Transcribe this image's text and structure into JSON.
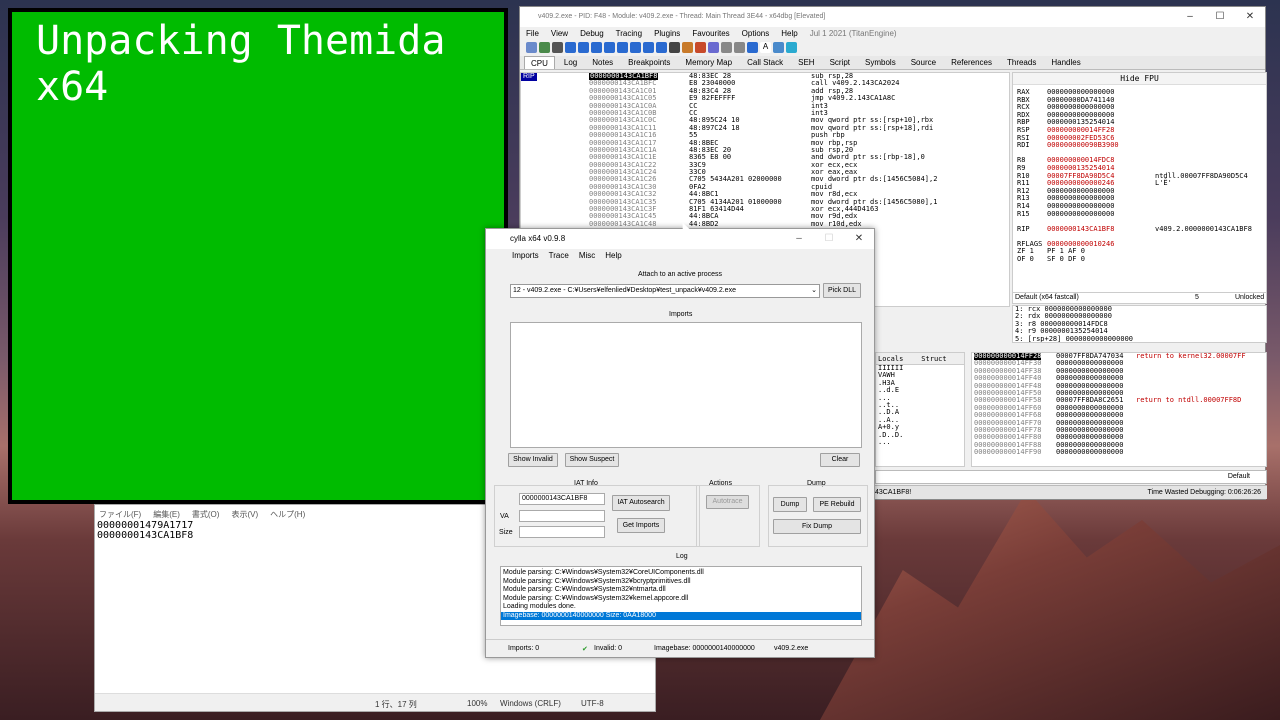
{
  "overlay": {
    "title": "Unpacking Themida x64"
  },
  "notepad": {
    "menu": [
      "ファイル(F)",
      "編集(E)",
      "書式(O)",
      "表示(V)",
      "ヘルプ(H)"
    ],
    "lines": [
      "00000001479A1717",
      "0000000143CA1BF8"
    ],
    "status": {
      "position": "1 行、17 列",
      "zoom": "100%",
      "eol": "Windows (CRLF)",
      "encoding": "UTF-8"
    }
  },
  "dbg": {
    "title": "v409.2.exe - PID: F48 - Module: v409.2.exe - Thread: Main Thread 3E44 - x64dbg [Elevated]",
    "menu": [
      "File",
      "View",
      "Debug",
      "Tracing",
      "Plugins",
      "Favourites",
      "Options",
      "Help",
      "Jul 1 2021 (TitanEngine)"
    ],
    "tabs": [
      "CPU",
      "Log",
      "Notes",
      "Breakpoints",
      "Memory Map",
      "Call Stack",
      "SEH",
      "Script",
      "Symbols",
      "Source",
      "References",
      "Threads",
      "Handles"
    ],
    "rip_tag": "RIP",
    "disasm": [
      {
        "addr": "0000000143CA1BF8",
        "bytes": "48:83EC 28",
        "instr": "sub rsp,28",
        "sel": true
      },
      {
        "addr": "0000000143CA1BFC",
        "bytes": "E8 23040000",
        "instr": "call v409.2.143CA2024"
      },
      {
        "addr": "0000000143CA1C01",
        "bytes": "48:83C4 28",
        "instr": "add rsp,28"
      },
      {
        "addr": "0000000143CA1C05",
        "bytes": "E9 82FEFFFF",
        "instr": "jmp v409.2.143CA1A8C"
      },
      {
        "addr": "0000000143CA1C0A",
        "bytes": "CC",
        "instr": "int3"
      },
      {
        "addr": "0000000143CA1C0B",
        "bytes": "CC",
        "instr": "int3"
      },
      {
        "addr": "0000000143CA1C0C",
        "bytes": "48:895C24 10",
        "instr": "mov qword ptr ss:[rsp+10],rbx"
      },
      {
        "addr": "0000000143CA1C11",
        "bytes": "48:897C24 18",
        "instr": "mov qword ptr ss:[rsp+18],rdi"
      },
      {
        "addr": "0000000143CA1C16",
        "bytes": "55",
        "instr": "push rbp"
      },
      {
        "addr": "0000000143CA1C17",
        "bytes": "48:8BEC",
        "instr": "mov rbp,rsp"
      },
      {
        "addr": "0000000143CA1C1A",
        "bytes": "48:83EC 20",
        "instr": "sub rsp,20"
      },
      {
        "addr": "0000000143CA1C1E",
        "bytes": "8365 E8 00",
        "instr": "and dword ptr ss:[rbp-18],0"
      },
      {
        "addr": "0000000143CA1C22",
        "bytes": "33C9",
        "instr": "xor ecx,ecx"
      },
      {
        "addr": "0000000143CA1C24",
        "bytes": "33C0",
        "instr": "xor eax,eax"
      },
      {
        "addr": "0000000143CA1C26",
        "bytes": "C705 5434A201 02000000",
        "instr": "mov dword ptr ds:[1456C5084],2"
      },
      {
        "addr": "0000000143CA1C30",
        "bytes": "0FA2",
        "instr": "cpuid"
      },
      {
        "addr": "0000000143CA1C32",
        "bytes": "44:8BC1",
        "instr": "mov r8d,ecx"
      },
      {
        "addr": "0000000143CA1C35",
        "bytes": "C705 4134A201 01000000",
        "instr": "mov dword ptr ds:[1456C5080],1"
      },
      {
        "addr": "0000000143CA1C3F",
        "bytes": "81F1 63414D44",
        "instr": "xor ecx,444D4163"
      },
      {
        "addr": "0000000143CA1C45",
        "bytes": "44:8BCA",
        "instr": "mov r9d,edx"
      },
      {
        "addr": "0000000143CA1C48",
        "bytes": "44:8BD2",
        "instr": "mov r10d,edx"
      }
    ],
    "regs_header": "Hide FPU",
    "regs": [
      {
        "n": "RAX",
        "v": "0000000000000000"
      },
      {
        "n": "RBX",
        "v": "00000000DA741140"
      },
      {
        "n": "RCX",
        "v": "0000000000000000"
      },
      {
        "n": "RDX",
        "v": "0000000000000000"
      },
      {
        "n": "RBP",
        "v": "0000000135254014"
      },
      {
        "n": "RSP",
        "v": "000000000014FF28",
        "red": true
      },
      {
        "n": "RSI",
        "v": "000000002FED53C6",
        "red": true
      },
      {
        "n": "RDI",
        "v": "000000000090B3900",
        "red": true
      },
      {
        "n": "",
        "v": ""
      },
      {
        "n": "R8",
        "v": "000000000014FDC8",
        "red": true
      },
      {
        "n": "R9",
        "v": "0000000135254014",
        "red": true
      },
      {
        "n": "R10",
        "v": "00007FF8DA90D5C4",
        "red": true,
        "c": "ntdll.00007FF8DA90D5C4"
      },
      {
        "n": "R11",
        "v": "0000000000000246",
        "red": true,
        "c": "L'Ȇ'"
      },
      {
        "n": "R12",
        "v": "0000000000000000"
      },
      {
        "n": "R13",
        "v": "0000000000000000"
      },
      {
        "n": "R14",
        "v": "0000000000000000"
      },
      {
        "n": "R15",
        "v": "0000000000000000"
      },
      {
        "n": "",
        "v": ""
      },
      {
        "n": "RIP",
        "v": "0000000143CA1BF8",
        "red": true,
        "c": "v409.2.0000000143CA1BF8"
      },
      {
        "n": "",
        "v": ""
      },
      {
        "n": "RFLAGS",
        "v": "0000000000010246",
        "red": true
      },
      {
        "n": "ZF 1",
        "v": "PF 1   AF 0"
      },
      {
        "n": "OF 0",
        "v": "SF 0   DF 0"
      }
    ],
    "callconv": "Default (x64 fastcall)",
    "callconv_num": "5",
    "unlocked": "Unlocked",
    "callstack": [
      "1: rcx 0000000000000000",
      "2: rdx 0000000000000000",
      "3: r8 000000000014FDC8",
      "4: r9 0000000135254014",
      "5: [rsp+28] 0000000000000000"
    ],
    "dump_tabs": [
      "Locals",
      "Struct"
    ],
    "dump_lines": [
      "IIIIII",
      "VAWH",
      ".H3A",
      "..d.E",
      "...",
      "..t..",
      "..D.A",
      "..A..",
      "A+0.y",
      ".D..D.",
      "..."
    ],
    "stack": [
      {
        "a": "000000000014FF28",
        "v": "00007FF8DA747034",
        "c": "return to kernel32.00007FF"
      },
      {
        "a": "000000000014FF30",
        "v": "0000000000000000",
        "c": ""
      },
      {
        "a": "000000000014FF38",
        "v": "0000000000000000",
        "c": ""
      },
      {
        "a": "000000000014FF40",
        "v": "0000000000000000",
        "c": ""
      },
      {
        "a": "000000000014FF48",
        "v": "0000000000000000",
        "c": ""
      },
      {
        "a": "000000000014FF50",
        "v": "0000000000000000",
        "c": ""
      },
      {
        "a": "000000000014FF58",
        "v": "00007FF8DA8C2651",
        "c": "return to ntdll.00007FF8D"
      },
      {
        "a": "000000000014FF60",
        "v": "0000000000000000",
        "c": ""
      },
      {
        "a": "000000000014FF68",
        "v": "0000000000000000",
        "c": ""
      },
      {
        "a": "000000000014FF70",
        "v": "0000000000000000",
        "c": ""
      },
      {
        "a": "000000000014FF78",
        "v": "0000000000000000",
        "c": ""
      },
      {
        "a": "000000000014FF80",
        "v": "0000000000000000",
        "c": ""
      },
      {
        "a": "000000000014FF88",
        "v": "0000000000000000",
        "c": ""
      },
      {
        "a": "000000000014FF90",
        "v": "0000000000000000",
        "c": ""
      }
    ],
    "cmd_default": "Default",
    "status_left": "43CA1BF8!",
    "status_right": "Time Wasted Debugging: 0:06:26:26"
  },
  "scylla": {
    "title": "cylla x64 v0.9.8",
    "menu": [
      "Imports",
      "Trace",
      "Misc",
      "Help"
    ],
    "attach_label": "Attach to an active process",
    "process": "12 - v409.2.exe - C:¥Users¥elfenlied¥Desktop¥test_unpack¥v409.2.exe",
    "pick_dll": "Pick DLL",
    "imports_label": "Imports",
    "show_invalid": "Show Invalid",
    "show_suspect": "Show Suspect",
    "clear": "Clear",
    "iat_label": "IAT Info",
    "oep_value": "0000000143CA1BF8",
    "va_label": "VA",
    "size_label": "Size",
    "iat_autosearch": "IAT Autosearch",
    "get_imports": "Get Imports",
    "actions_label": "Actions",
    "autotrace": "Autotrace",
    "dump_label": "Dump",
    "dump": "Dump",
    "pe_rebuild": "PE Rebuild",
    "fix_dump": "Fix Dump",
    "log_label": "Log",
    "log": [
      "Module parsing: C:¥Windows¥System32¥CoreUIComponents.dll",
      "Module parsing: C:¥Windows¥System32¥bcryptprimitives.dll",
      "Module parsing: C:¥Windows¥System32¥ntmarta.dll",
      "Module parsing: C:¥Windows¥System32¥kernel.appcore.dll",
      "Loading modules done.",
      "Imagebase: 0000000140000000 Size: 0AA18000"
    ],
    "status": {
      "imports": "Imports: 0",
      "invalid": "Invalid: 0",
      "imagebase": "Imagebase: 0000000140000000",
      "module": "v409.2.exe"
    }
  }
}
